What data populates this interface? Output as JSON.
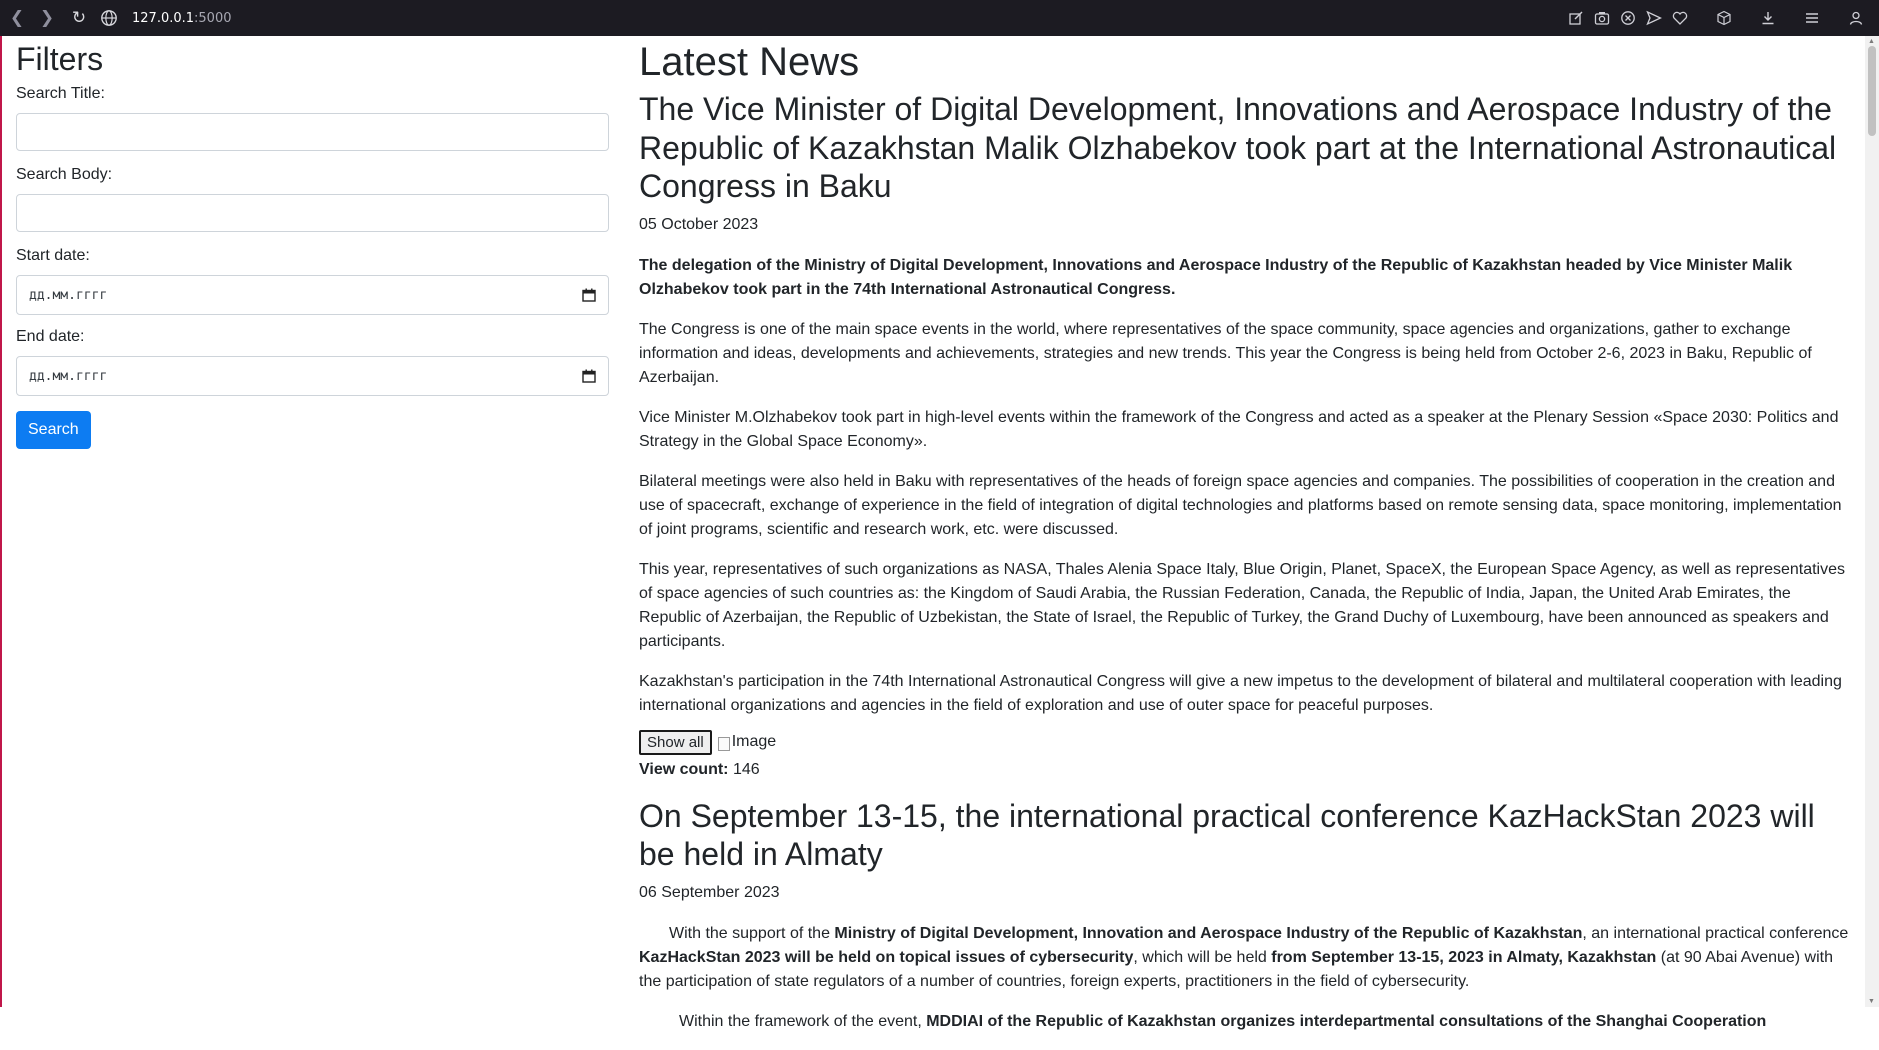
{
  "browser": {
    "url_host": "127.0.0.1",
    "url_port": ":5000",
    "icons": [
      "back-icon",
      "forward-icon",
      "reload-icon",
      "globe-icon",
      "edit-icon",
      "camera-icon",
      "close-circle-icon",
      "send-icon",
      "heart-icon",
      "cube-icon",
      "download-icon",
      "menu-icon",
      "profile-icon"
    ]
  },
  "filters": {
    "heading": "Filters",
    "search_title_label": "Search Title:",
    "search_body_label": "Search Body:",
    "start_date_label": "Start date:",
    "end_date_label": "End date:",
    "date_placeholder": "дд.мм.гггг",
    "search_button": "Search"
  },
  "news": {
    "heading": "Latest News",
    "articles": [
      {
        "title": "The Vice Minister of Digital Development, Innovations and Aerospace Industry of the Republic of Kazakhstan Malik Olzhabekov took part at the International Astronautical Congress in Baku",
        "date": "05 October 2023",
        "lead": "The delegation of the Ministry of Digital Development, Innovations and Aerospace Industry of the Republic of Kazakhstan headed by Vice Minister Malik Olzhabekov took part in the 74th International Astronautical Congress.",
        "paragraphs": [
          "The Congress is one of the main space events in the world, where representatives of the space community, space agencies and organizations, gather to exchange information and ideas, developments and achievements, strategies and new trends. This year the Congress is being held from October 2-6, 2023 in Baku, Republic of Azerbaijan.",
          "Vice Minister M.Olzhabekov took part in high-level events within the framework of the Congress and acted as a speaker at the Plenary Session «Space 2030: Politics and Strategy in the Global Space Economy».",
          "Bilateral meetings were also held in Baku with representatives of the heads of foreign space agencies and companies. The possibilities of cooperation in the creation and use of spacecraft, exchange of experience in the field of integration of digital technologies and platforms based on remote sensing data, space monitoring, implementation of joint programs, scientific and research work, etc. were discussed.",
          "This year, representatives of such organizations as NASA, Thales Alenia Space Italy, Blue Origin, Planet, SpaceX, the European Space Agency, as well as representatives of space agencies of such countries as: the Kingdom of Saudi Arabia, the Russian Federation, Canada, the Republic of India, Japan, the United Arab Emirates, the Republic of Azerbaijan, the Republic of Uzbekistan, the State of Israel, the Republic of Turkey, the Grand Duchy of Luxembourg, have been announced as speakers and participants.",
          "Kazakhstan's participation in the 74th International Astronautical Congress will give a new impetus to the development of bilateral and multilateral cooperation with leading international organizations and agencies in the field of exploration and use of outer space for peaceful purposes."
        ],
        "show_all": "Show all",
        "image_alt": "Image",
        "view_count_label": "View count:",
        "view_count": "146"
      },
      {
        "title": "On September 13-15, the international practical conference KazHackStan 2023 will be held in Almaty",
        "date": "06 September 2023",
        "p1_a": "With the support of the ",
        "p1_b": "Ministry of Digital Development, Innovation and Aerospace Industry of the Republic of Kazakhstan",
        "p1_c": ", an international practical conference ",
        "p1_d": "KazHackStan 2023 will be held on topical issues of cybersecurity",
        "p1_e": ", which will be held ",
        "p1_f": "from September 13-15, 2023 in Almaty, Kazakhstan",
        "p1_g": " (at 90 Abai Avenue) with the participation of state regulators of a number of countries, foreign experts, practitioners in the field of cybersecurity.",
        "p2_a": "Within the framework of the event, ",
        "p2_b": "MDDIAI of the Republic of Kazakhstan organizes interdepartmental consultations of the Shanghai Cooperation"
      }
    ]
  }
}
